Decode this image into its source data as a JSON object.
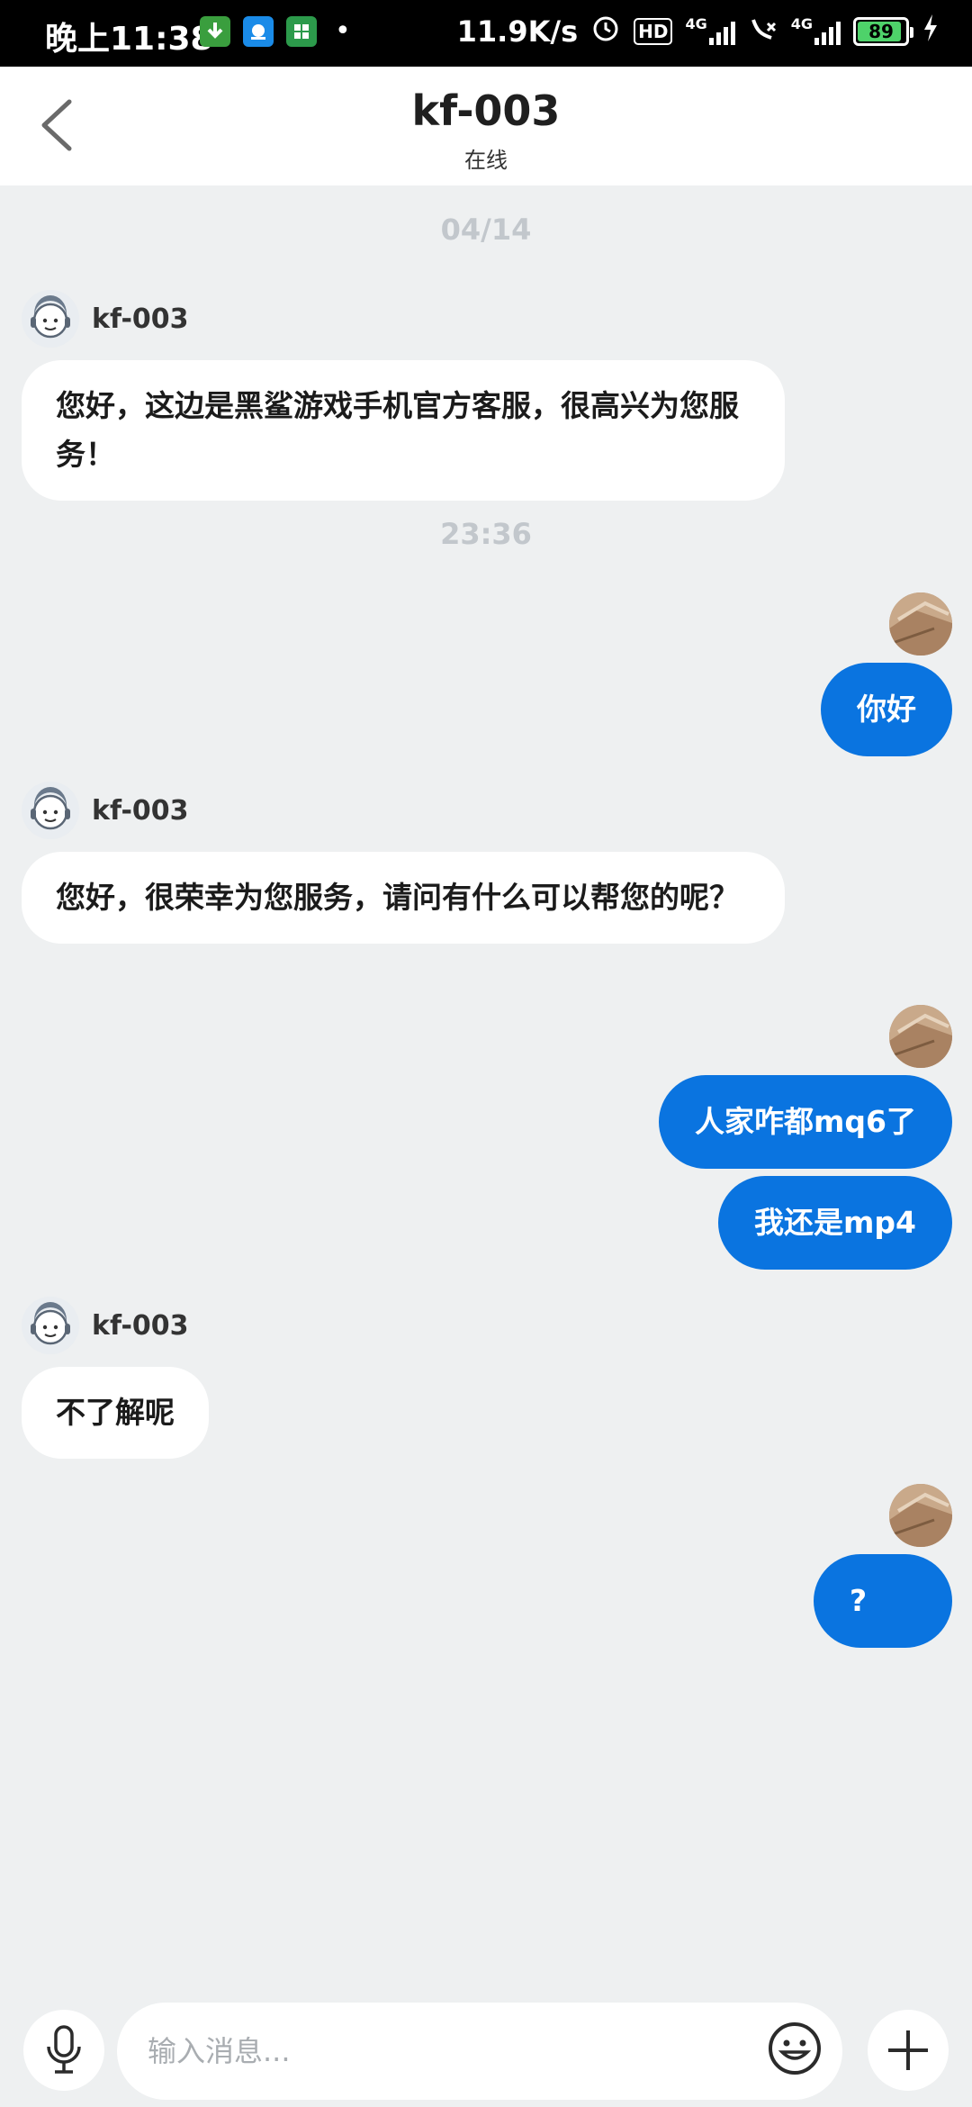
{
  "status_bar": {
    "time": "晚上11:38",
    "net_speed": "11.9K/s",
    "hd_badge": "HD",
    "network_1": "4G",
    "network_2": "4G",
    "battery": "89",
    "icons": [
      "download-icon",
      "app-icon",
      "calculator-icon",
      "alarm-icon",
      "hd-icon",
      "signal-icon",
      "call-icon",
      "signal-icon",
      "battery-icon",
      "charging-icon"
    ]
  },
  "header": {
    "title": "kf-003",
    "status": "在线",
    "back_icon": "chevron-left-icon"
  },
  "chat": {
    "timestamp_1": "04/14",
    "timestamp_2": "23:36",
    "agent_name": "kf-003",
    "messages": [
      {
        "from": "agent",
        "text": "您好，这边是黑鲨游戏手机官方客服，很高兴为您服务！"
      },
      {
        "from": "me",
        "text": "你好"
      },
      {
        "from": "agent",
        "text": "您好，很荣幸为您服务，请问有什么可以帮您的呢？"
      },
      {
        "from": "me",
        "text": "人家咋都mq6了"
      },
      {
        "from": "me",
        "text": "我还是mp4"
      },
      {
        "from": "agent",
        "text": "不了解呢"
      },
      {
        "from": "me",
        "text": "?"
      }
    ]
  },
  "input_bar": {
    "placeholder": "输入消息...",
    "mic_icon": "microphone-icon",
    "emoji_icon": "emoji-icon",
    "plus_icon": "plus-icon"
  },
  "colors": {
    "accent": "#0a74e0",
    "background": "#eef0f1",
    "bubble_in": "#ffffff"
  }
}
